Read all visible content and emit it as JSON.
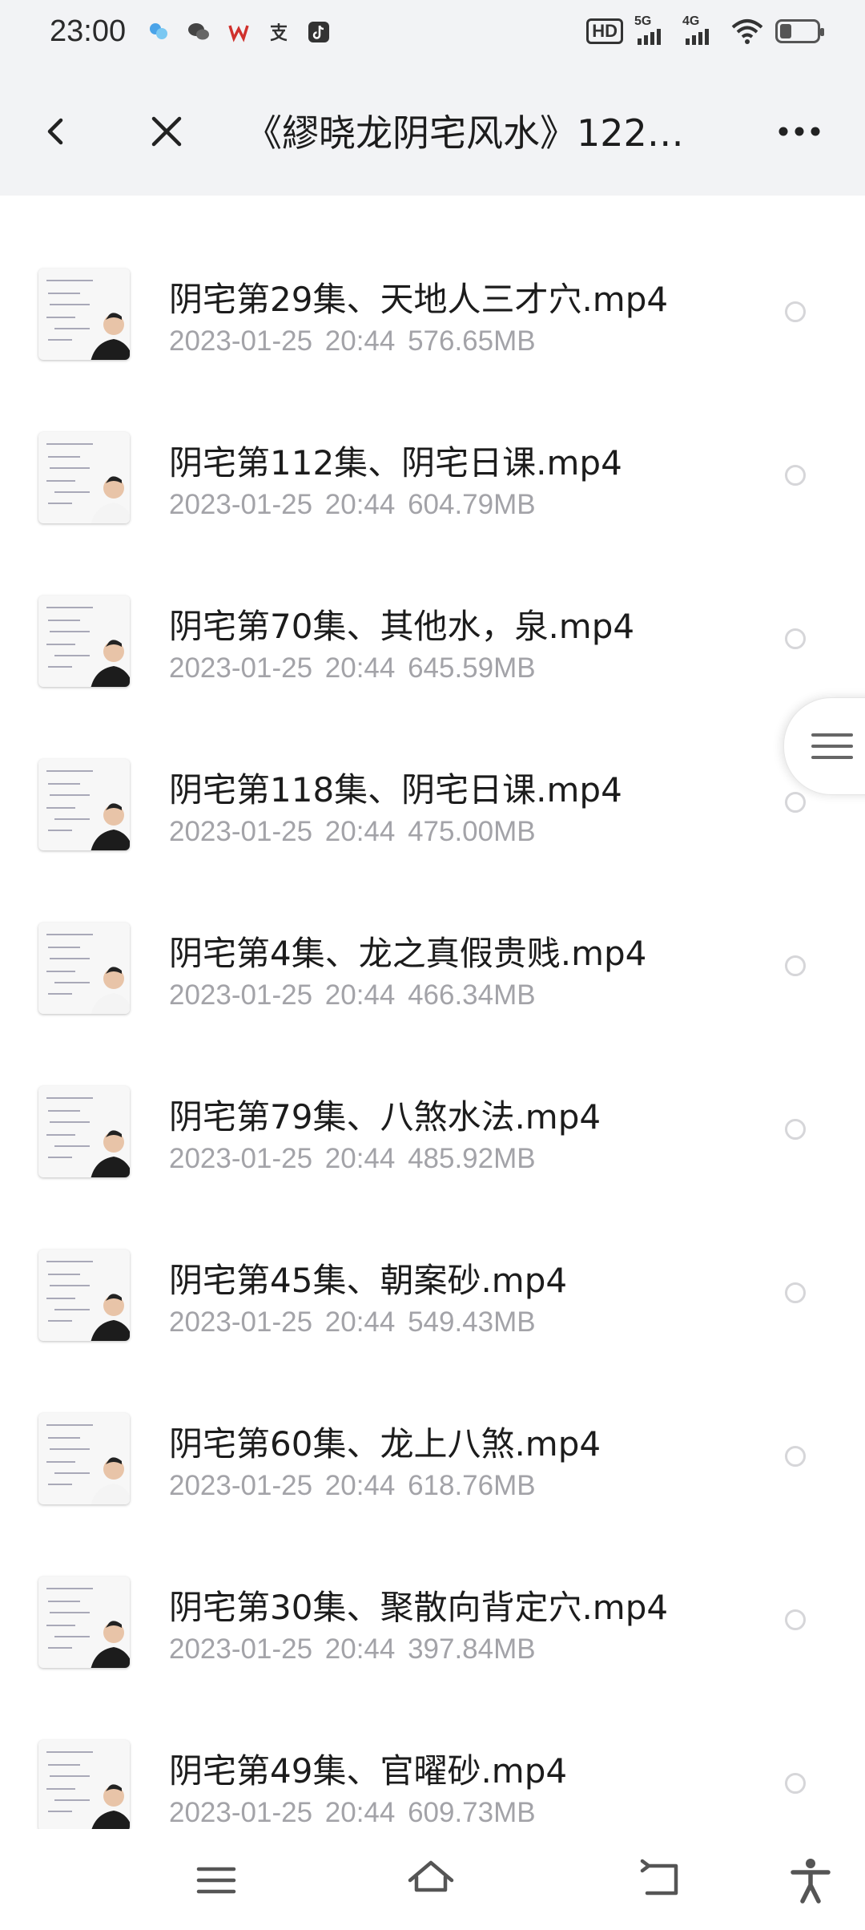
{
  "status_bar": {
    "time": "23:00",
    "app_icons": [
      "bluetooth-app-icon",
      "wechat-icon",
      "wps-icon",
      "alipay-icon",
      "tiktok-icon"
    ],
    "hd_badge": "HD",
    "sim1": "5G",
    "sim2": "4G",
    "battery_level": 0.3
  },
  "nav": {
    "title": "《繆晓龙阴宅风水》122…"
  },
  "files": [
    {
      "name": "阴宅第29集、天地人三才穴.mp4",
      "meta": "2023-01-25  20:44  576.65MB"
    },
    {
      "name": "阴宅第112集、阴宅日课.mp4",
      "meta": "2023-01-25  20:44  604.79MB"
    },
    {
      "name": "阴宅第70集、其他水，泉.mp4",
      "meta": "2023-01-25  20:44  645.59MB"
    },
    {
      "name": "阴宅第118集、阴宅日课.mp4",
      "meta": "2023-01-25  20:44  475.00MB"
    },
    {
      "name": "阴宅第4集、龙之真假贵贱.mp4",
      "meta": "2023-01-25  20:44  466.34MB"
    },
    {
      "name": "阴宅第79集、八煞水法.mp4",
      "meta": "2023-01-25  20:44  485.92MB"
    },
    {
      "name": "阴宅第45集、朝案砂.mp4",
      "meta": "2023-01-25  20:44  549.43MB"
    },
    {
      "name": "阴宅第60集、龙上八煞.mp4",
      "meta": "2023-01-25  20:44  618.76MB"
    },
    {
      "name": "阴宅第30集、聚散向背定穴.mp4",
      "meta": "2023-01-25  20:44  397.84MB"
    },
    {
      "name": "阴宅第49集、官曜砂.mp4",
      "meta": "2023-01-25  20:44  609.73MB"
    }
  ],
  "colors": {
    "header_bg": "#f2f3f5",
    "meta_text": "#a3a3a8",
    "radio_border": "#d6d6d9"
  }
}
